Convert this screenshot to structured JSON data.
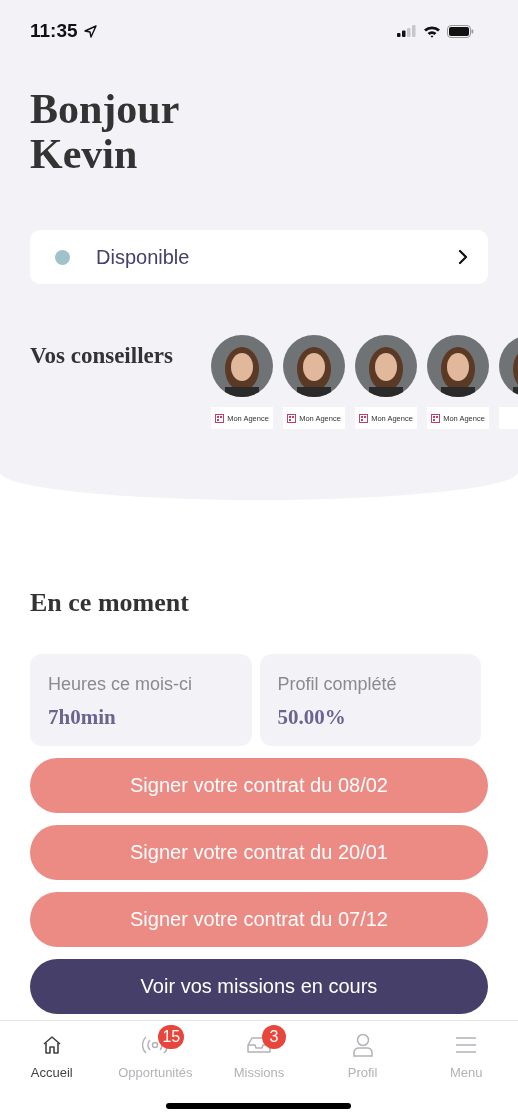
{
  "status_bar": {
    "time": "11:35"
  },
  "greeting": [
    "Bonjour",
    "Kevin"
  ],
  "availability": {
    "label": "Disponible",
    "color": "#9fc3c9"
  },
  "advisors": {
    "title": "Vos conseillers",
    "items": [
      {
        "agency": "Mon Agence"
      },
      {
        "agency": "Mon Agence"
      },
      {
        "agency": "Mon Agence"
      },
      {
        "agency": "Mon Agence"
      },
      {
        "kind": "cropped"
      }
    ]
  },
  "section_title": "En ce moment",
  "stats": [
    {
      "label": "Heures ce mois-ci",
      "value": "7h0min"
    },
    {
      "label": "Profil complété",
      "value": "50.00%"
    }
  ],
  "actions": [
    {
      "label": "Signer votre contrat du 08/02",
      "kind": "sign"
    },
    {
      "label": "Signer votre contrat du 20/01",
      "kind": "sign"
    },
    {
      "label": "Signer votre contrat du 07/12",
      "kind": "sign"
    },
    {
      "label": "Voir vos missions en cours",
      "kind": "primary"
    }
  ],
  "tabs": [
    {
      "label": "Accueil",
      "kind": "home",
      "selected": true
    },
    {
      "label": "Opportunités",
      "kind": "broadcast",
      "selected": false,
      "badge": "15"
    },
    {
      "label": "Missions",
      "kind": "inbox",
      "selected": false,
      "badge": "3"
    },
    {
      "label": "Profil",
      "kind": "profile",
      "selected": false
    },
    {
      "label": "Menu",
      "kind": "menu",
      "selected": false
    }
  ]
}
